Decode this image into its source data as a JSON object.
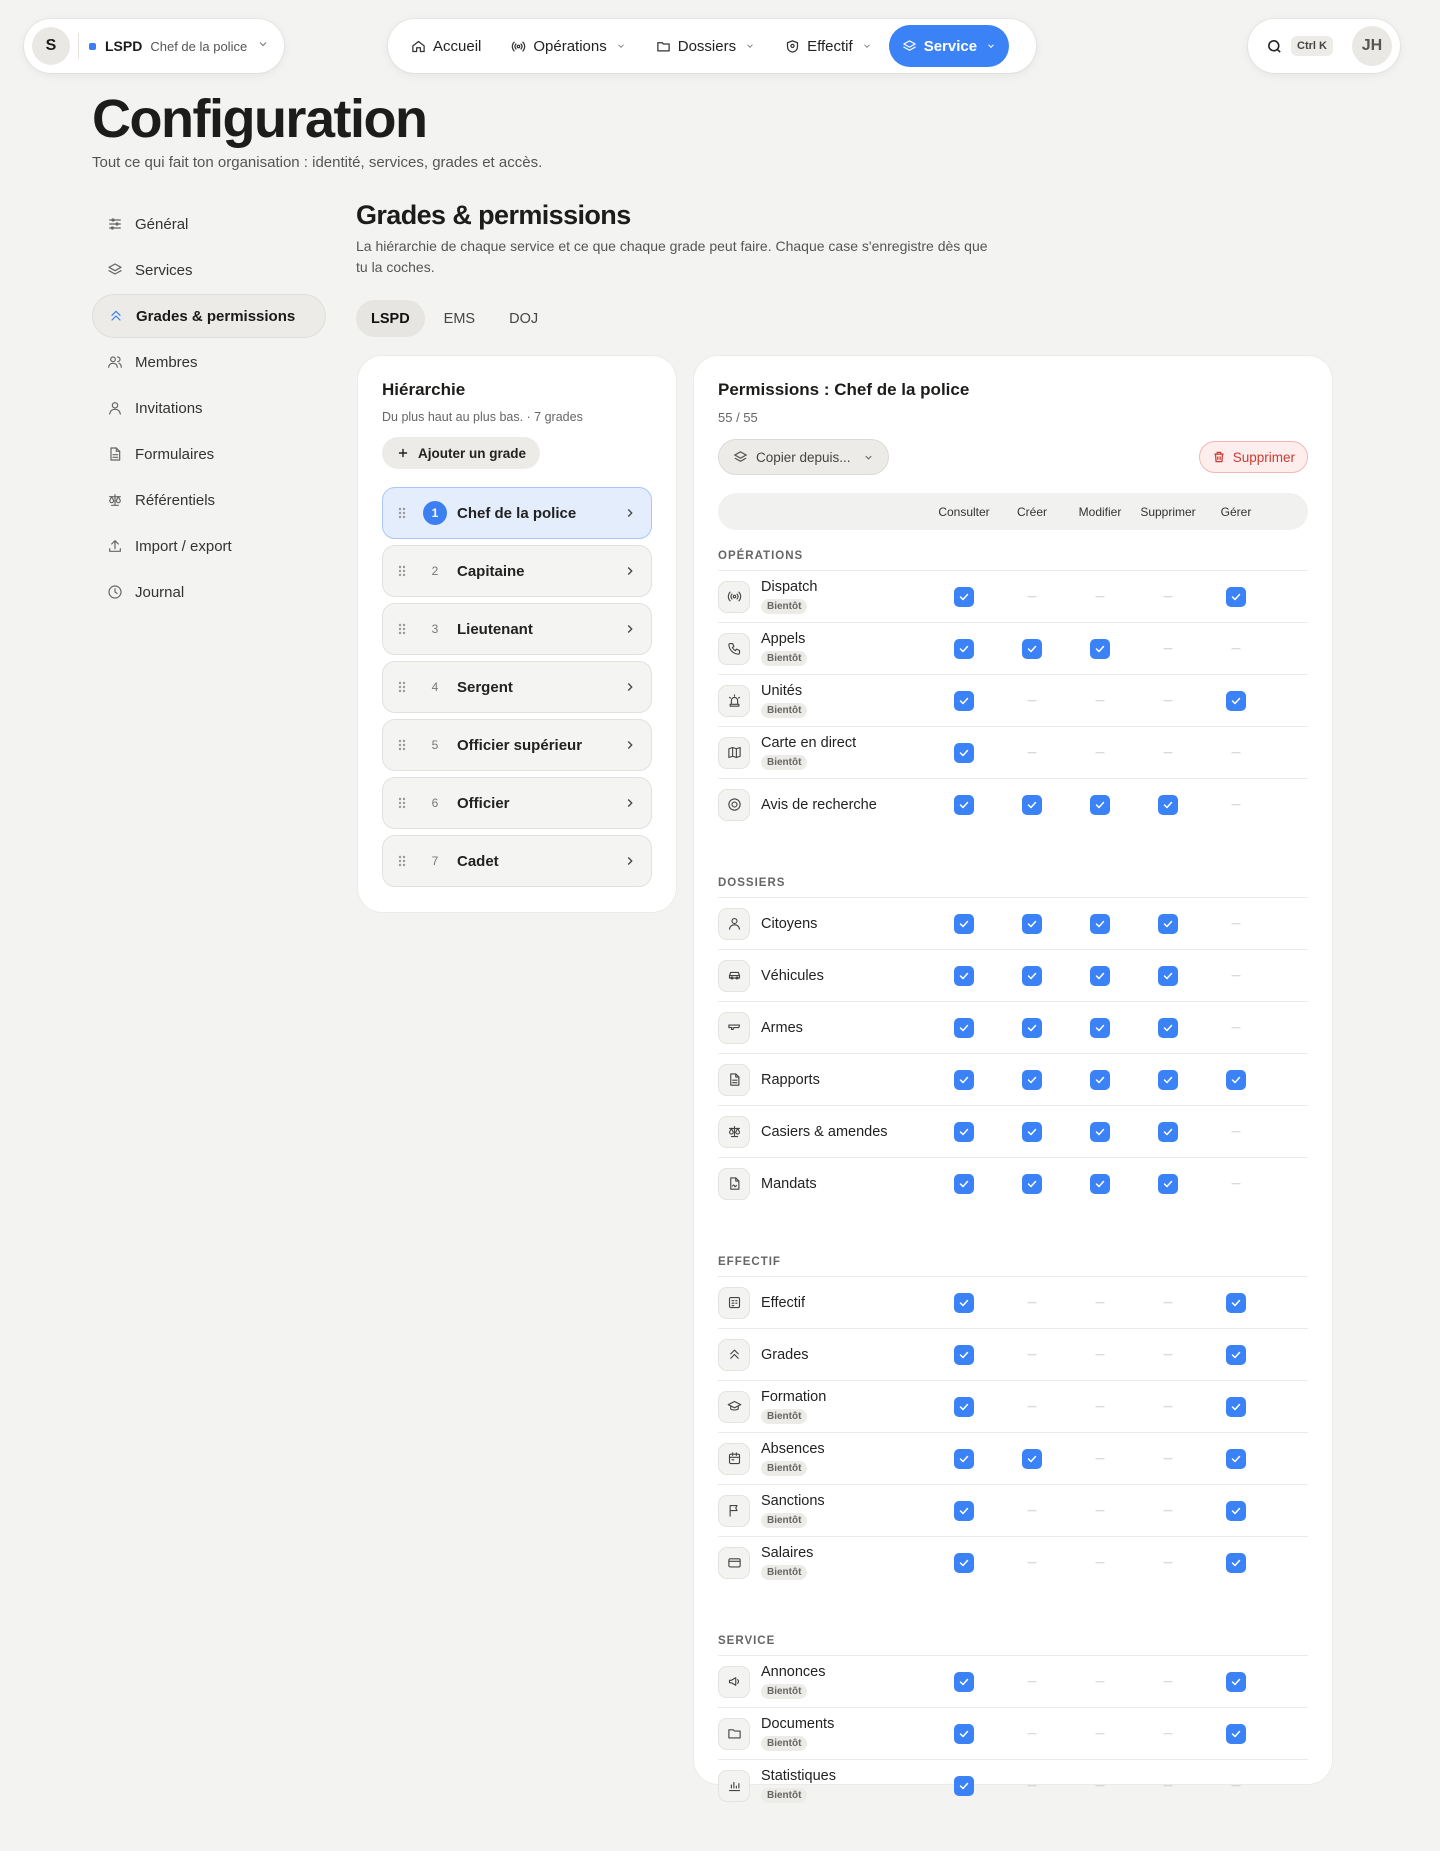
{
  "topbar": {
    "org_initial": "S",
    "org_code": "LSPD",
    "org_role": "Chef de la police",
    "nav": [
      {
        "label": "Accueil",
        "icon": "home-icon",
        "chevron": false,
        "active": false
      },
      {
        "label": "Opérations",
        "icon": "broadcast-icon",
        "chevron": true,
        "active": false
      },
      {
        "label": "Dossiers",
        "icon": "folder-icon",
        "chevron": true,
        "active": false
      },
      {
        "label": "Effectif",
        "icon": "shield-icon",
        "chevron": true,
        "active": false
      },
      {
        "label": "Service",
        "icon": "layers-icon",
        "chevron": true,
        "active": true
      }
    ],
    "search_shortcut": "Ctrl K",
    "user_initials": "JH",
    "accent": "#3b82f6"
  },
  "page": {
    "title": "Configuration",
    "subtitle": "Tout ce qui fait ton organisation : identité, services, grades et accès."
  },
  "sidebar": [
    {
      "label": "Général",
      "icon": "sliders-icon",
      "active": false
    },
    {
      "label": "Services",
      "icon": "layers-icon",
      "active": false
    },
    {
      "label": "Grades & permissions",
      "icon": "chevrons-up-icon",
      "active": true
    },
    {
      "label": "Membres",
      "icon": "users-icon",
      "active": false
    },
    {
      "label": "Invitations",
      "icon": "user-icon",
      "active": false
    },
    {
      "label": "Formulaires",
      "icon": "file-icon",
      "active": false
    },
    {
      "label": "Référentiels",
      "icon": "scale-icon",
      "active": false
    },
    {
      "label": "Import / export",
      "icon": "upload-icon",
      "active": false
    },
    {
      "label": "Journal",
      "icon": "clock-icon",
      "active": false
    }
  ],
  "section": {
    "title": "Grades & permissions",
    "description": "La hiérarchie de chaque service et ce que chaque grade peut faire. Chaque case s'enregistre dès que tu la coches.",
    "tabs": [
      {
        "label": "LSPD",
        "active": true
      },
      {
        "label": "EMS",
        "active": false
      },
      {
        "label": "DOJ",
        "active": false
      }
    ]
  },
  "hierarchy": {
    "title": "Hiérarchie",
    "subtitle": "Du plus haut au plus bas. · 7 grades",
    "add_label": "Ajouter un grade",
    "grades": [
      {
        "num": "1",
        "name": "Chef de la police",
        "active": true
      },
      {
        "num": "2",
        "name": "Capitaine",
        "active": false
      },
      {
        "num": "3",
        "name": "Lieutenant",
        "active": false
      },
      {
        "num": "4",
        "name": "Sergent",
        "active": false
      },
      {
        "num": "5",
        "name": "Officier supérieur",
        "active": false
      },
      {
        "num": "6",
        "name": "Officier",
        "active": false
      },
      {
        "num": "7",
        "name": "Cadet",
        "active": false
      }
    ]
  },
  "permissions": {
    "title": "Permissions : Chef de la police",
    "count": "55 / 55",
    "copy_label": "Copier depuis...",
    "delete_label": "Supprimer",
    "columns": [
      "Consulter",
      "Créer",
      "Modifier",
      "Supprimer",
      "Gérer"
    ],
    "soon_label": "Bientôt",
    "groups": [
      {
        "label": "OPÉRATIONS",
        "rows": [
          {
            "name": "Dispatch",
            "icon": "radio-icon",
            "soon": true,
            "perms": [
              1,
              0,
              0,
              0,
              1
            ]
          },
          {
            "name": "Appels",
            "icon": "phone-icon",
            "soon": true,
            "perms": [
              1,
              1,
              1,
              0,
              0
            ]
          },
          {
            "name": "Unités",
            "icon": "siren-icon",
            "soon": true,
            "perms": [
              1,
              0,
              0,
              0,
              1
            ]
          },
          {
            "name": "Carte en direct",
            "icon": "map-icon",
            "soon": true,
            "perms": [
              1,
              0,
              0,
              0,
              0
            ]
          },
          {
            "name": "Avis de recherche",
            "icon": "target-icon",
            "soon": false,
            "perms": [
              1,
              1,
              1,
              1,
              0
            ]
          }
        ]
      },
      {
        "label": "DOSSIERS",
        "rows": [
          {
            "name": "Citoyens",
            "icon": "user-icon",
            "soon": false,
            "perms": [
              1,
              1,
              1,
              1,
              0
            ]
          },
          {
            "name": "Véhicules",
            "icon": "car-icon",
            "soon": false,
            "perms": [
              1,
              1,
              1,
              1,
              0
            ]
          },
          {
            "name": "Armes",
            "icon": "gun-icon",
            "soon": false,
            "perms": [
              1,
              1,
              1,
              1,
              0
            ]
          },
          {
            "name": "Rapports",
            "icon": "file-icon",
            "soon": false,
            "perms": [
              1,
              1,
              1,
              1,
              1
            ]
          },
          {
            "name": "Casiers & amendes",
            "icon": "scale-icon",
            "soon": false,
            "perms": [
              1,
              1,
              1,
              1,
              0
            ]
          },
          {
            "name": "Mandats",
            "icon": "file-sign-icon",
            "soon": false,
            "perms": [
              1,
              1,
              1,
              1,
              0
            ]
          }
        ]
      },
      {
        "label": "EFFECTIF",
        "rows": [
          {
            "name": "Effectif",
            "icon": "roster-icon",
            "soon": false,
            "perms": [
              1,
              0,
              0,
              0,
              1
            ]
          },
          {
            "name": "Grades",
            "icon": "chevrons-up-icon",
            "soon": false,
            "perms": [
              1,
              0,
              0,
              0,
              1
            ]
          },
          {
            "name": "Formation",
            "icon": "graduation-icon",
            "soon": true,
            "perms": [
              1,
              0,
              0,
              0,
              1
            ]
          },
          {
            "name": "Absences",
            "icon": "calendar-icon",
            "soon": true,
            "perms": [
              1,
              1,
              0,
              0,
              1
            ]
          },
          {
            "name": "Sanctions",
            "icon": "flag-icon",
            "soon": true,
            "perms": [
              1,
              0,
              0,
              0,
              1
            ]
          },
          {
            "name": "Salaires",
            "icon": "wallet-icon",
            "soon": true,
            "perms": [
              1,
              0,
              0,
              0,
              1
            ]
          }
        ]
      },
      {
        "label": "SERVICE",
        "rows": [
          {
            "name": "Annonces",
            "icon": "megaphone-icon",
            "soon": true,
            "perms": [
              1,
              0,
              0,
              0,
              1
            ]
          },
          {
            "name": "Documents",
            "icon": "folder-icon",
            "soon": true,
            "perms": [
              1,
              0,
              0,
              0,
              1
            ]
          },
          {
            "name": "Statistiques",
            "icon": "chart-icon",
            "soon": true,
            "perms": [
              1,
              0,
              0,
              0,
              0
            ]
          }
        ]
      }
    ]
  }
}
